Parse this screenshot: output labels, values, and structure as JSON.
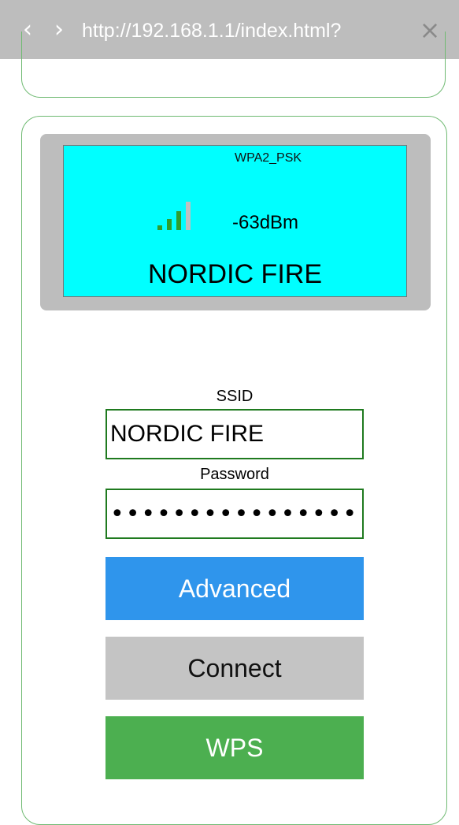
{
  "browser": {
    "back_icon": "‹",
    "forward_icon": "›",
    "url": "http://192.168.1.1/index.html?",
    "close_icon": "×"
  },
  "network_display": {
    "security": "WPA2_PSK",
    "signal_strength": "-63dBm",
    "signal_bars_active": 3,
    "signal_bars_total": 4,
    "name": "NORDIC FIRE",
    "colors": {
      "screen": "#00ffff",
      "bar_active": "#2e9e2e",
      "bar_inactive": "#c0c0c0"
    }
  },
  "form": {
    "ssid_label": "SSID",
    "ssid_value": "NORDIC FIRE",
    "password_label": "Password",
    "password_value": "••••••••••••••••"
  },
  "buttons": {
    "advanced": "Advanced",
    "connect": "Connect",
    "wps": "WPS"
  }
}
